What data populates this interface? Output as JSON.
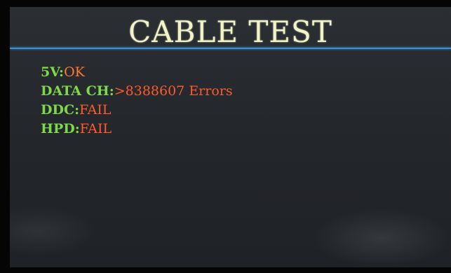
{
  "screen": {
    "title": "CABLE TEST"
  },
  "results": [
    {
      "label": "5V:",
      "value": "OK"
    },
    {
      "label": "DATA CH:",
      "value": ">8388607 Errors"
    },
    {
      "label": "DDC:",
      "value": "FAIL"
    },
    {
      "label": "HPD:",
      "value": "FAIL"
    }
  ],
  "colors": {
    "title": "#f2f3c8",
    "label": "#7dd84a",
    "value": "#ff5a2a",
    "rule": "#3a8fd6",
    "background": "#26292d"
  }
}
